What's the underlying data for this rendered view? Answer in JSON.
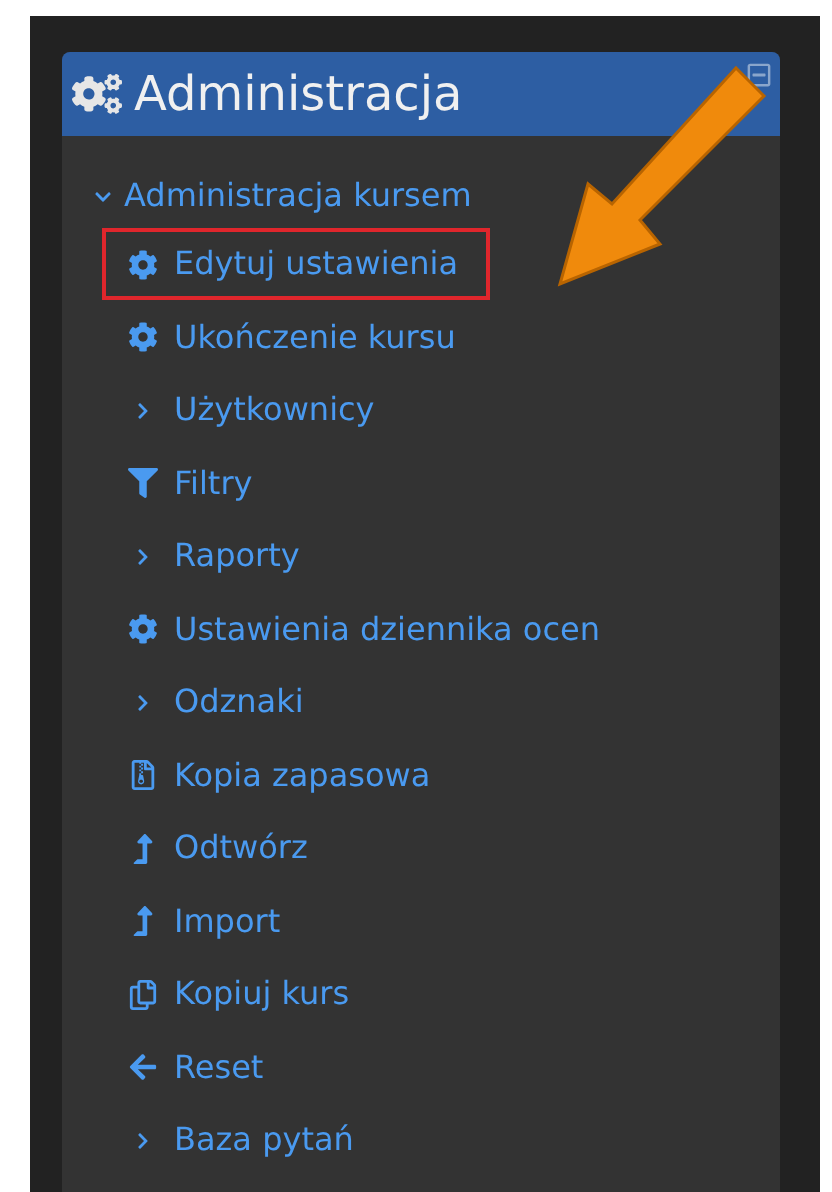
{
  "block": {
    "title": "Administracja"
  },
  "tree": {
    "label": "Administracja kursem",
    "expanded": true,
    "children": [
      {
        "kind": "settings",
        "label": "Edytuj ustawienia",
        "highlighted": true
      },
      {
        "kind": "settings",
        "label": "Ukończenie kursu",
        "highlighted": false
      },
      {
        "kind": "group",
        "label": "Użytkownicy",
        "expanded": false,
        "highlighted": false
      },
      {
        "kind": "filter",
        "label": "Filtry",
        "highlighted": false
      },
      {
        "kind": "group",
        "label": "Raporty",
        "expanded": false,
        "highlighted": false
      },
      {
        "kind": "settings",
        "label": "Ustawienia dziennika ocen",
        "highlighted": false
      },
      {
        "kind": "group",
        "label": "Odznaki",
        "expanded": false,
        "highlighted": false
      },
      {
        "kind": "archive",
        "label": "Kopia zapasowa",
        "highlighted": false
      },
      {
        "kind": "upload",
        "label": "Odtwórz",
        "highlighted": false
      },
      {
        "kind": "upload",
        "label": "Import",
        "highlighted": false
      },
      {
        "kind": "copy",
        "label": "Kopiuj kurs",
        "highlighted": false
      },
      {
        "kind": "back",
        "label": "Reset",
        "highlighted": false
      },
      {
        "kind": "group",
        "label": "Baza pytań",
        "expanded": false,
        "highlighted": false
      }
    ]
  }
}
